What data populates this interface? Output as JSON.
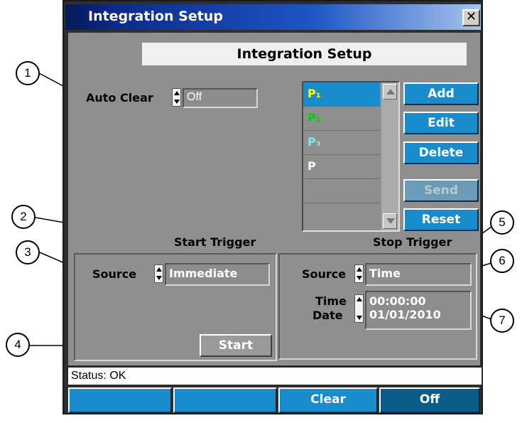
{
  "window": {
    "title": "Integration Setup",
    "close_glyph": "✕"
  },
  "header": {
    "title": "Integration Setup"
  },
  "auto_clear": {
    "label": "Auto Clear",
    "value": "Off"
  },
  "list": {
    "items": [
      {
        "label": "P₁",
        "color": "#ffff00",
        "selected": true
      },
      {
        "label": "P₂",
        "color": "#00d000",
        "selected": false
      },
      {
        "label": "P₃",
        "color": "#7fe6f0",
        "selected": false
      },
      {
        "label": "P",
        "color": "#ffffff",
        "selected": false
      },
      {
        "label": "",
        "selected": false
      },
      {
        "label": "",
        "selected": false
      }
    ]
  },
  "buttons": {
    "add": "Add",
    "edit": "Edit",
    "delete": "Delete",
    "send": "Send",
    "reset": "Reset"
  },
  "start_trigger": {
    "label": "Start Trigger",
    "source_label": "Source",
    "source_value": "Immediate",
    "start_button": "Start"
  },
  "stop_trigger": {
    "label": "Stop Trigger",
    "source_label": "Source",
    "source_value": "Time",
    "time_label": "Time",
    "date_label": "Date",
    "time_value": "00:00:00",
    "date_value": "01/01/2010"
  },
  "status": {
    "text": "Status: OK"
  },
  "bottom_bar": {
    "buttons": [
      "",
      "",
      "Clear",
      "Off"
    ]
  },
  "callouts": [
    "1",
    "2",
    "3",
    "4",
    "5",
    "6",
    "7"
  ],
  "colors": {
    "accent": "#1a8ccc",
    "panel": "#8f8f8f",
    "frame": "#2f2f2f",
    "title_gradient_start": "#071a58"
  }
}
